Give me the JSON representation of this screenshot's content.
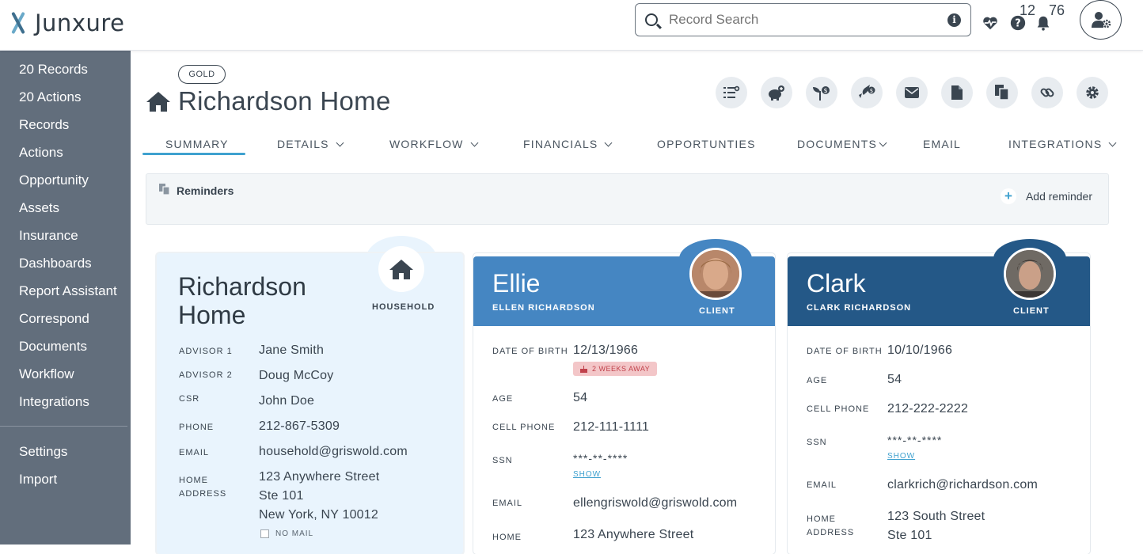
{
  "app": {
    "name": "Junxure"
  },
  "header": {
    "search_placeholder": "Record Search",
    "help_count": "12",
    "notification_count": "76"
  },
  "sidebar": {
    "items": [
      "20 Records",
      "20 Actions",
      "Records",
      "Actions",
      "Opportunity",
      "Assets",
      "Insurance",
      "Dashboards",
      "Report Assistant",
      "Correspond",
      "Documents",
      "Workflow",
      "Integrations"
    ],
    "footer_items": [
      "Settings",
      "Import"
    ]
  },
  "record": {
    "badge": "GOLD",
    "title": "Richardson Home"
  },
  "actions": [
    "task-list-icon",
    "piggy-bank-add-icon",
    "money-plant-icon",
    "rocket-money-icon",
    "envelope-icon",
    "document-icon",
    "copy-document-icon",
    "link-icon",
    "gear-icon"
  ],
  "tabs": [
    {
      "label": "SUMMARY",
      "dropdown": false,
      "active": true
    },
    {
      "label": "DETAILS",
      "dropdown": true
    },
    {
      "label": "WORKFLOW",
      "dropdown": true
    },
    {
      "label": "FINANCIALS",
      "dropdown": true
    },
    {
      "label": "OPPORTUNTIES",
      "dropdown": false
    },
    {
      "label": "DOCUMENTS",
      "dropdown": true
    },
    {
      "label": "EMAIL",
      "dropdown": false
    },
    {
      "label": "INTEGRATIONS",
      "dropdown": true
    }
  ],
  "reminders": {
    "title": "Reminders",
    "add_label": "Add reminder"
  },
  "household": {
    "name_line1": "Richardson",
    "name_line2": "Home",
    "role": "HOUSEHOLD",
    "fields": [
      {
        "label": "ADVISOR 1",
        "value": "Jane Smith"
      },
      {
        "label": "ADVISOR 2",
        "value": "Doug McCoy"
      },
      {
        "label": "CSR",
        "value": "John Doe"
      },
      {
        "label": "PHONE",
        "value": "212-867-5309"
      },
      {
        "label": "EMAIL",
        "value": "household@griswold.com"
      }
    ],
    "address_label_1": "HOME",
    "address_label_2": "ADDRESS",
    "address_line1": "123 Anywhere Street",
    "address_line2": "Ste 101",
    "address_line3": "New York, NY 10012",
    "no_mail_label": "NO MAIL"
  },
  "ellie": {
    "name": "Ellie",
    "full_name": "ELLEN RICHARDSON",
    "role": "CLIENT",
    "dob_label": "DATE OF BIRTH",
    "dob": "12/13/1966",
    "dob_pill": "2 WEEKS AWAY",
    "age_label": "AGE",
    "age": "54",
    "cell_label": "CELL PHONE",
    "cell": "212-111-1111",
    "ssn_label": "SSN",
    "ssn": "***-**-****",
    "show": "SHOW",
    "email_label": "EMAIL",
    "email": "ellengriswold@griswold.com",
    "home_label": "HOME",
    "home": "123 Anywhere Street"
  },
  "clark": {
    "name": "Clark",
    "full_name": "CLARK RICHARDSON",
    "role": "CLIENT",
    "dob_label": "DATE OF BIRTH",
    "dob": "10/10/1966",
    "age_label": "AGE",
    "age": "54",
    "cell_label": "CELL PHONE",
    "cell": "212-222-2222",
    "ssn_label": "SSN",
    "ssn": "***-**-****",
    "show": "SHOW",
    "email_label": "EMAIL",
    "email": "clarkrich@richardson.com",
    "address_label_1": "HOME",
    "address_label_2": "ADDRESS",
    "address_line1": "123 South Street",
    "address_line2": "Ste 101"
  },
  "colors": {
    "accent": "#3fa1cf",
    "sidebar": "#626e7c",
    "ellie_header": "#4586c2",
    "clark_header": "#245887",
    "household_bg": "#e9f4fd"
  }
}
